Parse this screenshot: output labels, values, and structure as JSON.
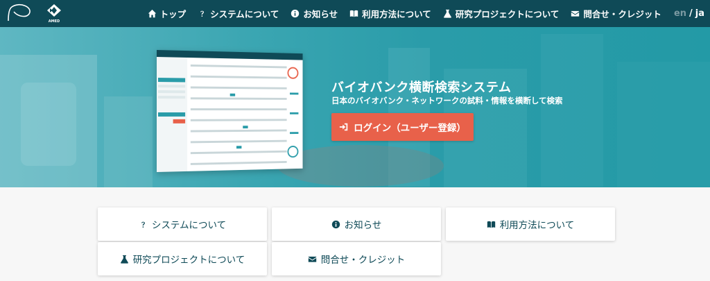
{
  "nav": {
    "items": [
      {
        "label": "トップ",
        "icon": "home-icon"
      },
      {
        "label": "システムについて",
        "icon": "question-icon"
      },
      {
        "label": "お知らせ",
        "icon": "info-icon"
      },
      {
        "label": "利用方法について",
        "icon": "book-icon"
      },
      {
        "label": "研究プロジェクトについて",
        "icon": "flask-icon"
      },
      {
        "label": "問合せ・クレジット",
        "icon": "envelope-icon"
      }
    ],
    "lang_en": "en",
    "lang_sep": "/",
    "lang_ja": "ja"
  },
  "hero": {
    "title": "バイオバンク横断検索システム",
    "subtitle": "日本のバイオバンク・ネットワークの試料・情報を横断して検索",
    "login_label": "ログイン（ユーザー登録）",
    "logo_text": "AMED"
  },
  "cards": [
    {
      "label": "システムについて",
      "icon": "question-icon"
    },
    {
      "label": "お知らせ",
      "icon": "info-icon"
    },
    {
      "label": "利用方法について",
      "icon": "book-icon"
    },
    {
      "label": "研究プロジェクトについて",
      "icon": "flask-icon"
    },
    {
      "label": "問合せ・クレジット",
      "icon": "envelope-icon"
    }
  ],
  "colors": {
    "navbar": "#0f4a57",
    "hero": "#2a9ca9",
    "login_button": "#e8614a",
    "card_text": "#0f4a57"
  }
}
